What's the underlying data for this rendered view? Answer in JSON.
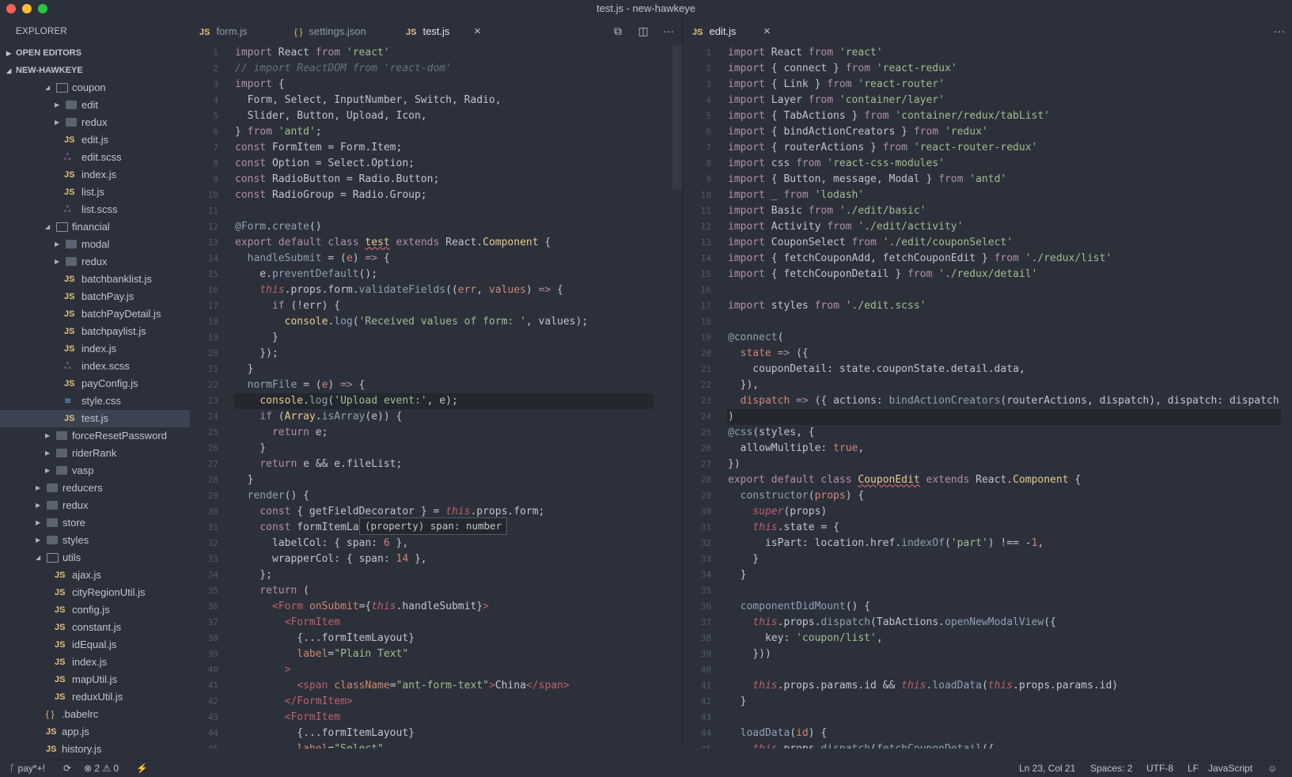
{
  "window": {
    "title": "test.js - new-hawkeye"
  },
  "sidebar": {
    "title": "EXPLORER",
    "open_editors": "OPEN EDITORS",
    "project": "NEW-HAWKEYE",
    "tree": [
      {
        "label": "coupon",
        "type": "folder",
        "level": 1,
        "open": true
      },
      {
        "label": "edit",
        "type": "folder",
        "level": 2,
        "open": false
      },
      {
        "label": "redux",
        "type": "folder",
        "level": 2,
        "open": false
      },
      {
        "label": "edit.js",
        "type": "js",
        "level": 2
      },
      {
        "label": "edit.scss",
        "type": "scss",
        "level": 2
      },
      {
        "label": "index.js",
        "type": "js",
        "level": 2
      },
      {
        "label": "list.js",
        "type": "js",
        "level": 2
      },
      {
        "label": "list.scss",
        "type": "scss",
        "level": 2
      },
      {
        "label": "financial",
        "type": "folder",
        "level": 1,
        "open": true
      },
      {
        "label": "modal",
        "type": "folder",
        "level": 2,
        "open": false
      },
      {
        "label": "redux",
        "type": "folder",
        "level": 2,
        "open": false
      },
      {
        "label": "batchbanklist.js",
        "type": "js",
        "level": 2
      },
      {
        "label": "batchPay.js",
        "type": "js",
        "level": 2
      },
      {
        "label": "batchPayDetail.js",
        "type": "js",
        "level": 2
      },
      {
        "label": "batchpaylist.js",
        "type": "js",
        "level": 2
      },
      {
        "label": "index.js",
        "type": "js",
        "level": 2
      },
      {
        "label": "index.scss",
        "type": "scss",
        "level": 2
      },
      {
        "label": "payConfig.js",
        "type": "js",
        "level": 2
      },
      {
        "label": "style.css",
        "type": "css",
        "level": 2
      },
      {
        "label": "test.js",
        "type": "js",
        "level": 2,
        "selected": true
      },
      {
        "label": "forceResetPassword",
        "type": "folder",
        "level": 1,
        "open": false
      },
      {
        "label": "riderRank",
        "type": "folder",
        "level": 1,
        "open": false
      },
      {
        "label": "vasp",
        "type": "folder",
        "level": 1,
        "open": false
      },
      {
        "label": "reducers",
        "type": "folder",
        "level": 0,
        "open": false
      },
      {
        "label": "redux",
        "type": "folder",
        "level": 0,
        "open": false
      },
      {
        "label": "store",
        "type": "folder",
        "level": 0,
        "open": false
      },
      {
        "label": "styles",
        "type": "folder",
        "level": 0,
        "open": false
      },
      {
        "label": "utils",
        "type": "folder",
        "level": 0,
        "open": true
      },
      {
        "label": "ajax.js",
        "type": "js",
        "level": 1
      },
      {
        "label": "cityRegionUtil.js",
        "type": "js",
        "level": 1
      },
      {
        "label": "config.js",
        "type": "js",
        "level": 1
      },
      {
        "label": "constant.js",
        "type": "js",
        "level": 1
      },
      {
        "label": "idEqual.js",
        "type": "js",
        "level": 1
      },
      {
        "label": "index.js",
        "type": "js",
        "level": 1
      },
      {
        "label": "mapUtil.js",
        "type": "js",
        "level": 1
      },
      {
        "label": "reduxUtil.js",
        "type": "js",
        "level": 1
      },
      {
        "label": ".babelrc",
        "type": "json",
        "level": -1
      },
      {
        "label": "app.js",
        "type": "js",
        "level": -1
      },
      {
        "label": "history.js",
        "type": "js",
        "level": -1
      }
    ]
  },
  "icons": {
    "js": "JS",
    "json": "{ }",
    "close": "×",
    "more": "···"
  },
  "left_editor": {
    "tabs": [
      {
        "label": "form.js",
        "icon": "JS"
      },
      {
        "label": "settings.json",
        "icon": "{ }"
      },
      {
        "label": "test.js",
        "icon": "JS",
        "active": true
      }
    ],
    "hover_tooltip": "(property) span: number"
  },
  "right_editor": {
    "tabs": [
      {
        "label": "edit.js",
        "icon": "JS",
        "active": true
      }
    ]
  },
  "status": {
    "branch": "pay*+!",
    "errors": "2",
    "warnings": "0",
    "position": "Ln 23, Col 21",
    "spaces": "Spaces: 2",
    "encoding": "UTF-8",
    "eol": "LF",
    "language": "JavaScript"
  }
}
